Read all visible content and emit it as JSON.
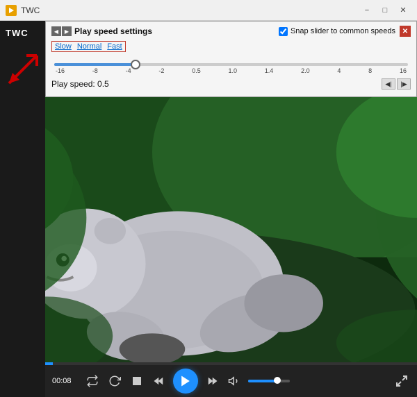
{
  "titleBar": {
    "appTitle": "TWC",
    "controls": {
      "minimize": "−",
      "maximize": "□",
      "close": "✕"
    }
  },
  "popup": {
    "title": "Play speed settings",
    "speedLabels": [
      "Slow",
      "Normal",
      "Fast"
    ],
    "snapLabel": "Snap slider to common speeds",
    "playSpeed": "Play speed: 0.5",
    "sliderValue": 0.5,
    "sliderTicks": [
      "-16",
      "-8",
      "-4",
      "-2",
      "0.5",
      "1.0",
      "1.4",
      "2.0",
      "4",
      "8",
      "16"
    ]
  },
  "controls": {
    "timeDisplay": "00:08",
    "progressPercent": 2
  },
  "icons": {
    "grid": "⊞",
    "prevNav": "◀",
    "nextNav": "▶",
    "close": "✕",
    "rewind": "⟨⟨",
    "forward": "⟩⟩",
    "play": "▶",
    "stop": "■",
    "prev": "◀◀",
    "next": "▶▶",
    "volume": "🔊",
    "fullscreen": "⛶",
    "fineBack": "◀|",
    "fineForward": "|▶"
  }
}
